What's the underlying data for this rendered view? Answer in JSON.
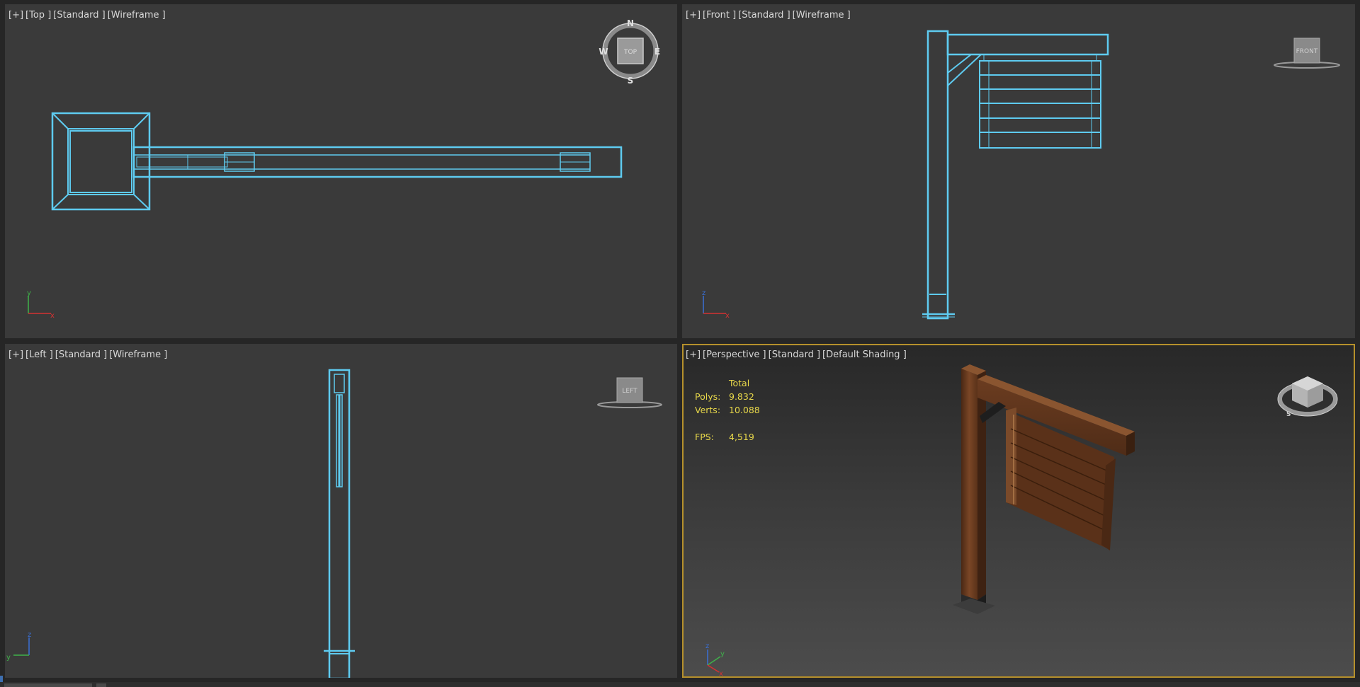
{
  "viewports": {
    "top": {
      "label": {
        "plus": "[+]",
        "view": "[Top ]",
        "preset": "[Standard ]",
        "shading": "[Wireframe ]"
      },
      "compass": {
        "n": "N",
        "s": "S",
        "e": "E",
        "w": "W",
        "cube": "TOP"
      },
      "axes": {
        "v": "y",
        "h": "x"
      }
    },
    "front": {
      "label": {
        "plus": "[+]",
        "view": "[Front ]",
        "preset": "[Standard ]",
        "shading": "[Wireframe ]"
      },
      "cube": "FRONT",
      "axes": {
        "v": "z",
        "h": "x"
      }
    },
    "left": {
      "label": {
        "plus": "[+]",
        "view": "[Left ]",
        "preset": "[Standard ]",
        "shading": "[Wireframe ]"
      },
      "cube": "LEFT",
      "axes": {
        "v": "z",
        "h": "y"
      }
    },
    "perspective": {
      "label": {
        "plus": "[+]",
        "view": "[Perspective ]",
        "preset": "[Standard ]",
        "shading": "[Default Shading ]"
      },
      "stats": {
        "header": "Total",
        "polys_label": "Polys:",
        "polys": "9.832",
        "verts_label": "Verts:",
        "verts": "10.088",
        "fps_label": "FPS:",
        "fps": "4,519"
      },
      "axes": {
        "z": "z",
        "y": "y",
        "x": "x"
      }
    }
  },
  "colors": {
    "wire": "#5ecbf0",
    "active_border": "#b5902b",
    "stats_text": "#e8d84a",
    "viewport_bg": "#3a3a3a",
    "wood": "#6b3e22"
  },
  "icons": [
    "viewcube-icon",
    "compass-icon",
    "axis-tripod-icon"
  ]
}
